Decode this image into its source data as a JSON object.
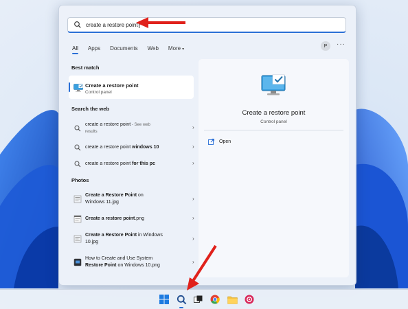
{
  "search": {
    "query": "create a restore point"
  },
  "tabs": [
    {
      "label": "All"
    },
    {
      "label": "Apps"
    },
    {
      "label": "Documents"
    },
    {
      "label": "Web"
    },
    {
      "label": "More"
    }
  ],
  "account_initial": "P",
  "more_options": "···",
  "best_match": {
    "heading": "Best match",
    "title": "Create a restore point",
    "subtitle": "Control panel"
  },
  "web": {
    "heading": "Search the web",
    "items": [
      {
        "plain": "create a restore point",
        "bold": "",
        "sub": " - See web",
        "sub2": "results"
      },
      {
        "plain": "create a restore point ",
        "bold": "windows 10",
        "sub": "",
        "sub2": ""
      },
      {
        "plain": "create a restore point ",
        "bold": "for this pc",
        "sub": "",
        "sub2": ""
      }
    ]
  },
  "photos": {
    "heading": "Photos",
    "items": [
      {
        "bold1": "Create a Restore Point",
        "plain1": " on",
        "line2": "Windows 11.jpg"
      },
      {
        "bold1": "Create a restore point",
        "plain1": ".png",
        "line2": ""
      },
      {
        "bold1": "Create a Restore Point",
        "plain1": " in Windows",
        "line2": "10.jpg"
      },
      {
        "bold1": "",
        "plain1": "How to Create and Use System",
        "line2b": "Restore Point",
        "line2": " on Windows 10.png"
      }
    ]
  },
  "detail": {
    "title": "Create a restore point",
    "subtitle": "Control panel",
    "open_label": "Open"
  },
  "taskbar": {
    "items": [
      "windows-start",
      "search",
      "task-view",
      "chrome",
      "file-explorer",
      "app"
    ]
  },
  "colors": {
    "accent": "#2a6fd6",
    "annotation_arrow": "#e0211b"
  }
}
